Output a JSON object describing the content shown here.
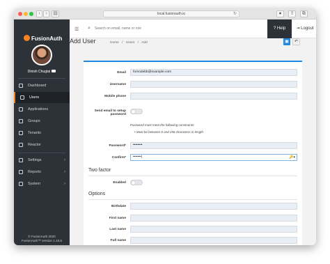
{
  "browser": {
    "address": "local.fusionauth.io",
    "reload_icon": "reload-icon"
  },
  "brand": {
    "name": "FusionAuth"
  },
  "user": {
    "name": "Dinish Chugtai"
  },
  "nav": {
    "items": [
      {
        "label": "Dashboard",
        "icon": "dashboard-icon"
      },
      {
        "label": "Users",
        "icon": "users-icon"
      },
      {
        "label": "Applications",
        "icon": "applications-icon"
      },
      {
        "label": "Groups",
        "icon": "groups-icon"
      },
      {
        "label": "Tenants",
        "icon": "tenants-icon"
      },
      {
        "label": "Reactor",
        "icon": "reactor-icon"
      },
      {
        "label": "Settings",
        "icon": "settings-icon"
      },
      {
        "label": "Reports",
        "icon": "reports-icon"
      },
      {
        "label": "System",
        "icon": "system-icon"
      }
    ],
    "active": "Users"
  },
  "footer": {
    "line1": "© FusionAuth 2020",
    "line2": "FusionAuth™ version 1.15.6"
  },
  "topbar": {
    "search_placeholder": "Search on email, name or role",
    "help_label": "Help",
    "logout_label": "Logout"
  },
  "page": {
    "title": "Add User",
    "breadcrumbs": [
      "Home",
      "/",
      "Users",
      "/",
      "Add"
    ]
  },
  "form": {
    "email_label": "Email",
    "email_value": "fornodebb@example.com",
    "username_label": "Username",
    "mobile_label": "Mobile phone",
    "send_email_label_1": "Send email to setup",
    "send_email_label_2": "password",
    "password_constraints": "Password must meet the following constraints:",
    "password_rule": "•  Must be between 8 and 256 characters in length",
    "password_label": "Password*",
    "password_value": "••••••••",
    "confirm_label": "Confirm*",
    "confirm_value": "•••••••|",
    "two_factor_heading": "Two factor",
    "enabled_label": "Enabled",
    "options_heading": "Options",
    "birthdate_label": "Birthdate",
    "first_name_label": "First name",
    "last_name_label": "Last name",
    "full_name_label": "Full name"
  },
  "colors": {
    "sidebar": "#2d3238",
    "accent": "#f58320",
    "primary": "#1e88e5"
  }
}
